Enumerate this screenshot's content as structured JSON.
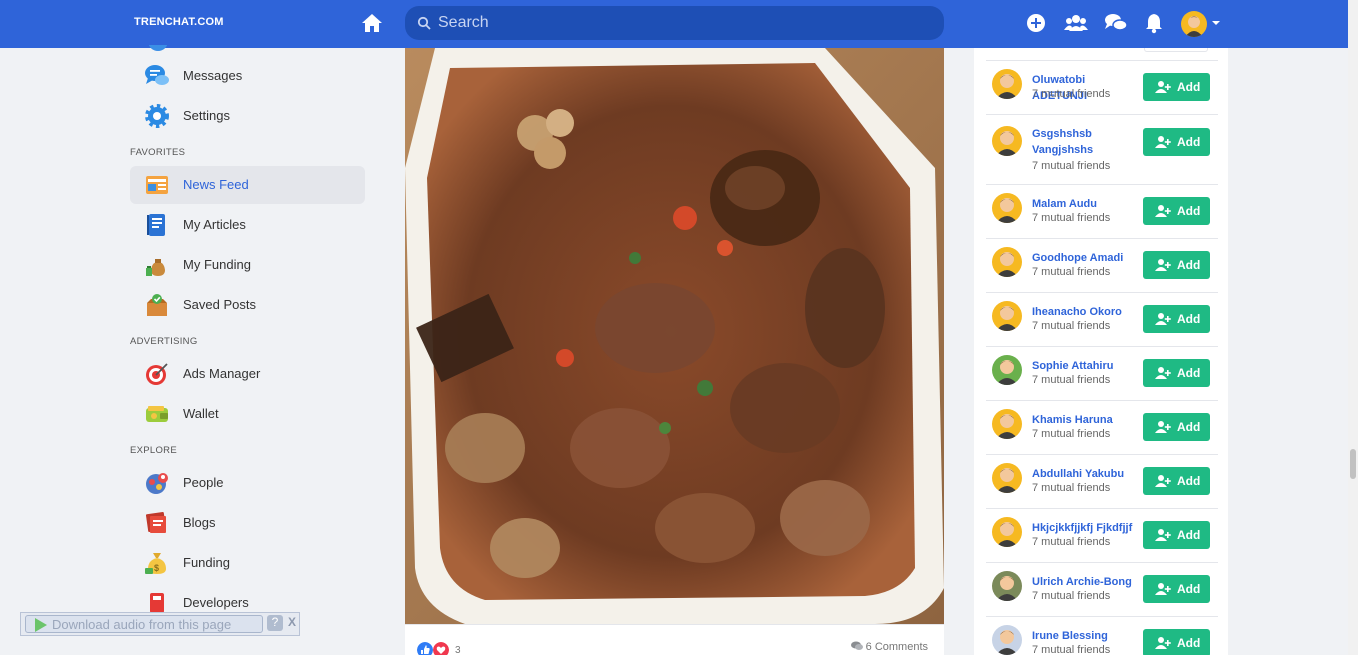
{
  "brand": {
    "name": "TRENCHAT.COM",
    "accent": "#2f64d9",
    "add_color": "#1fba84"
  },
  "search": {
    "placeholder": "Search"
  },
  "topbar": {
    "icons": [
      "home-icon",
      "plus-circle-icon",
      "users-icon",
      "chat-icon",
      "bell-icon",
      "avatar",
      "caret-down-icon"
    ]
  },
  "sidebar": {
    "top_items": [
      {
        "label": "Messages",
        "icon": "messages-icon"
      },
      {
        "label": "Settings",
        "icon": "settings-icon"
      }
    ],
    "favorites_heading": "FAVORITES",
    "favorites": [
      {
        "label": "News Feed",
        "icon": "news-feed-icon",
        "active": true
      },
      {
        "label": "My Articles",
        "icon": "articles-icon"
      },
      {
        "label": "My Funding",
        "icon": "funding-icon"
      },
      {
        "label": "Saved Posts",
        "icon": "saved-posts-icon"
      }
    ],
    "advertising_heading": "ADVERTISING",
    "advertising": [
      {
        "label": "Ads Manager",
        "icon": "target-icon"
      },
      {
        "label": "Wallet",
        "icon": "wallet-icon"
      }
    ],
    "explore_heading": "EXPLORE",
    "explore": [
      {
        "label": "People",
        "icon": "people-icon"
      },
      {
        "label": "Blogs",
        "icon": "blogs-icon"
      },
      {
        "label": "Funding",
        "icon": "money-bag-icon"
      },
      {
        "label": "Developers",
        "icon": "developers-icon"
      }
    ]
  },
  "post": {
    "reaction_count": "3",
    "comments": "6 Comments"
  },
  "suggestions": {
    "add_label": "Add",
    "people": [
      {
        "name": "Oluwatobi ADETUNJI",
        "mutual": "7 mutual friends"
      },
      {
        "name": "Gsgshshsb Vangjshshs",
        "mutual": "7 mutual friends"
      },
      {
        "name": "Malam Audu",
        "mutual": "7 mutual friends"
      },
      {
        "name": "Goodhope Amadi",
        "mutual": "7 mutual friends"
      },
      {
        "name": "Iheanacho Okoro",
        "mutual": "7 mutual friends"
      },
      {
        "name": "Sophie Attahiru",
        "mutual": "7 mutual friends"
      },
      {
        "name": "Khamis Haruna",
        "mutual": "7 mutual friends"
      },
      {
        "name": "Abdullahi Yakubu",
        "mutual": "7 mutual friends"
      },
      {
        "name": "Hkjcjkkfjjkfj Fjkdfjjf",
        "mutual": "7 mutual friends"
      },
      {
        "name": "Ulrich Archie-Bong",
        "mutual": "7 mutual friends"
      },
      {
        "name": "Irune Blessing",
        "mutual": "7 mutual friends"
      }
    ]
  },
  "download_bar": {
    "label": "Download audio from this page",
    "help": "?",
    "close": "X"
  }
}
